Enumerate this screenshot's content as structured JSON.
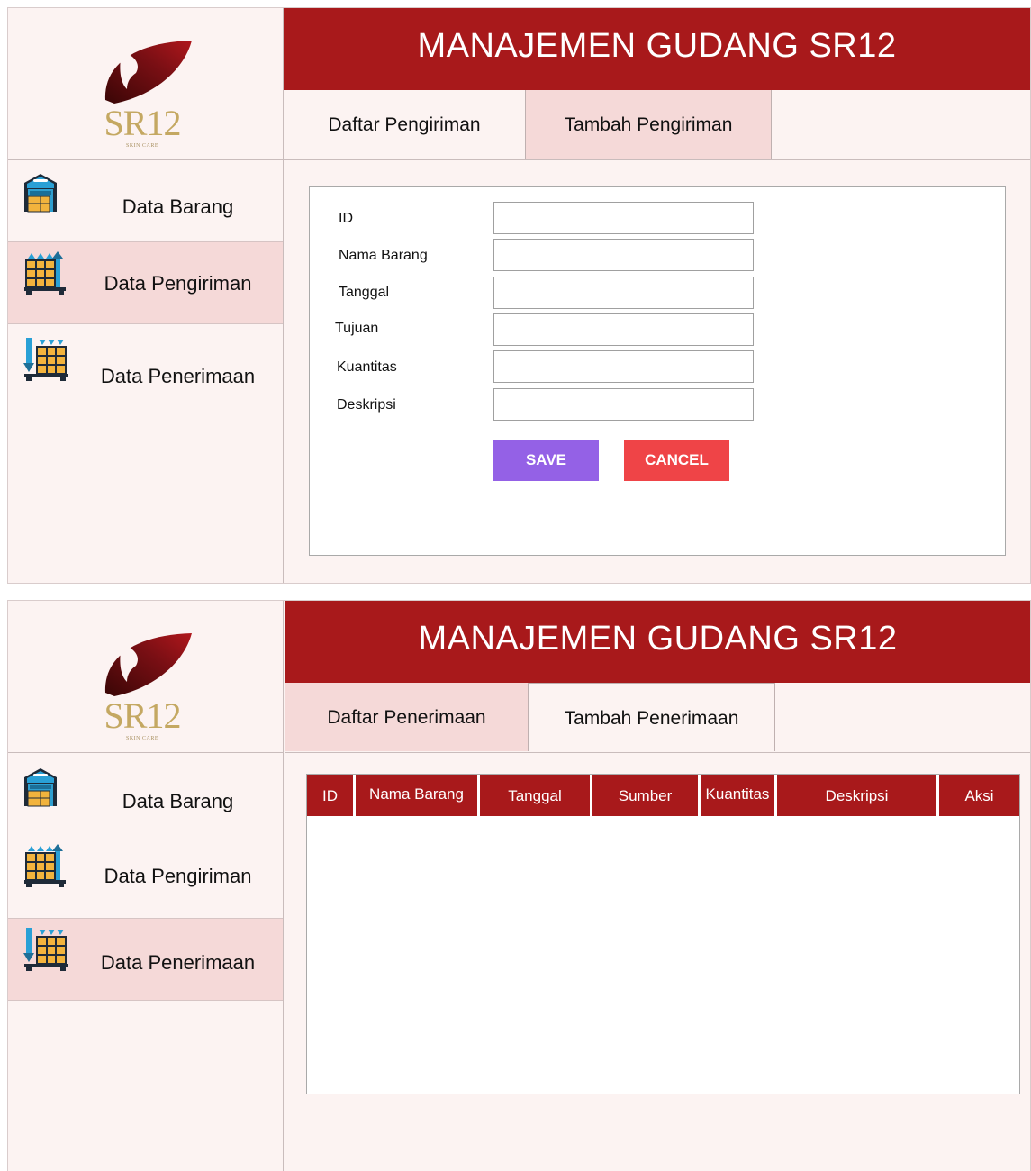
{
  "app": {
    "title": "MANAJEMEN GUDANG SR12",
    "logo_text": "SR12",
    "logo_subtext": "SKIN CARE"
  },
  "sidebar": {
    "items": [
      {
        "label": "Data Barang",
        "icon": "warehouse-icon"
      },
      {
        "label": "Data Pengiriman",
        "icon": "boxes-outgoing-icon"
      },
      {
        "label": "Data Penerimaan",
        "icon": "boxes-incoming-icon"
      }
    ]
  },
  "screen1": {
    "active_nav": "Data Pengiriman",
    "tabs": [
      {
        "label": "Daftar Pengiriman",
        "active": false
      },
      {
        "label": "Tambah Pengiriman",
        "active": true
      }
    ],
    "form": {
      "fields": [
        {
          "label": "ID",
          "value": ""
        },
        {
          "label": "Nama Barang",
          "value": ""
        },
        {
          "label": "Tanggal",
          "value": ""
        },
        {
          "label": "Tujuan",
          "value": ""
        },
        {
          "label": "Kuantitas",
          "value": ""
        },
        {
          "label": "Deskripsi",
          "value": ""
        }
      ],
      "save_label": "SAVE",
      "cancel_label": "CANCEL"
    }
  },
  "screen2": {
    "active_nav": "Data Penerimaan",
    "tabs": [
      {
        "label": "Daftar Penerimaan",
        "active": true
      },
      {
        "label": "Tambah Penerimaan",
        "active": false
      }
    ],
    "table": {
      "columns": [
        "ID",
        "Nama Barang",
        "Tanggal",
        "Sumber",
        "Kuantitas",
        "Deskripsi",
        "Aksi"
      ],
      "rows": []
    }
  },
  "colors": {
    "primary": "#a8191b",
    "background": "#fcf3f2",
    "active": "#f5d9d8",
    "save": "#9461e6",
    "cancel": "#ef4447",
    "logo_gold": "#c4a862"
  }
}
